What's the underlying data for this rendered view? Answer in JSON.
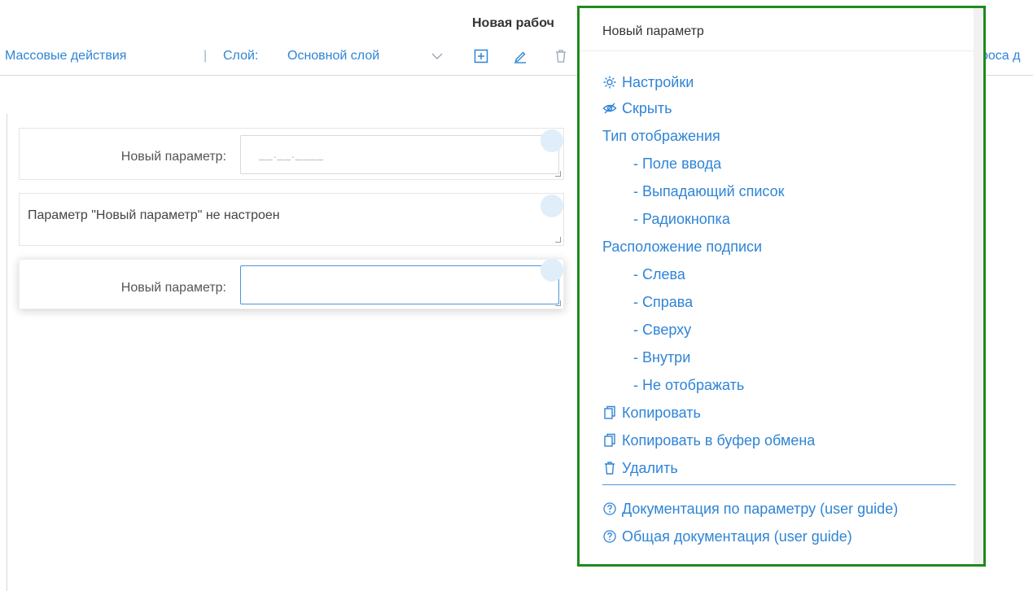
{
  "header": {
    "title": "Новая рабоч"
  },
  "toolbar": {
    "mass_actions": "Массовые действия",
    "separator": "|",
    "layer_label": "Слой:",
    "layer_value": "Основной слой",
    "right_text": "роса д"
  },
  "form": {
    "row1": {
      "label": "Новый параметр:",
      "value": "__.__.____"
    },
    "row2": {
      "message": "Параметр \"Новый параметр\" не настроен"
    },
    "row3": {
      "label": "Новый параметр:",
      "value": ""
    }
  },
  "menu": {
    "title": "Новый параметр",
    "items": {
      "settings": "Настройки",
      "hide": "Скрыть",
      "display_type": "Тип отображения",
      "input_field": "- Поле ввода",
      "dropdown": "- Выпадающий список",
      "radio": "- Радиокнопка",
      "label_position": "Расположение подписи",
      "left": "- Слева",
      "right": "- Справа",
      "top": "- Сверху",
      "inside": "- Внутри",
      "none": "- Не отображать",
      "copy": "Копировать",
      "copy_clipboard": "Копировать в буфер обмена",
      "delete": "Удалить",
      "param_docs": "Документация по параметру (user guide)",
      "general_docs": "Общая документация (user guide)"
    }
  },
  "colors": {
    "accent": "#2f84d6",
    "highlight_border": "#1e8a1e"
  }
}
